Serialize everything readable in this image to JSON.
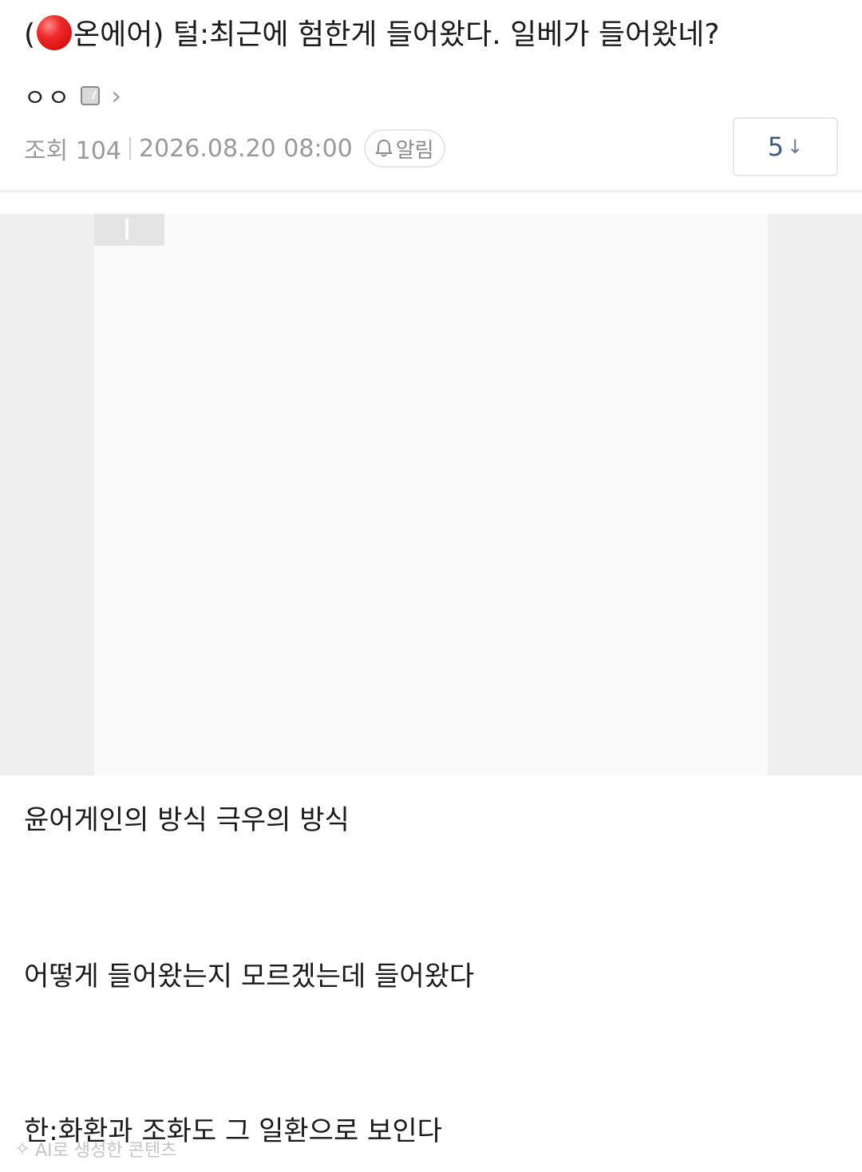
{
  "post": {
    "title_open": "(",
    "title_after_dot": "온에어) 털:최근에 험한게 들어왔다. 일베가 들어왔네?",
    "title_dot_icon": "red-circle-icon",
    "author": "ㅇㅇ",
    "level_icon": "level-badge-icon",
    "chevron": "›",
    "views_label": "조회 104",
    "datetime": "2026.08.20 08:00",
    "alarm_label": "알림",
    "comment_count": "5",
    "comment_arrow": "↓"
  },
  "body": {
    "line1": "윤어게인의 방식 극우의 방식",
    "line2": "어떻게 들어왔는지 모르겠는데 들어왔다",
    "line3": "한:화환과 조화도 그 일환으로 보인다"
  },
  "watermark": {
    "icon": "sparkle-icon",
    "text": "AI로 생성한 콘텐츠"
  },
  "colors": {
    "title_text": "#1a1a1a",
    "meta_text": "#9a9a9a",
    "comment_count": "#3d5a80",
    "red_dot": "#e01e1e"
  }
}
